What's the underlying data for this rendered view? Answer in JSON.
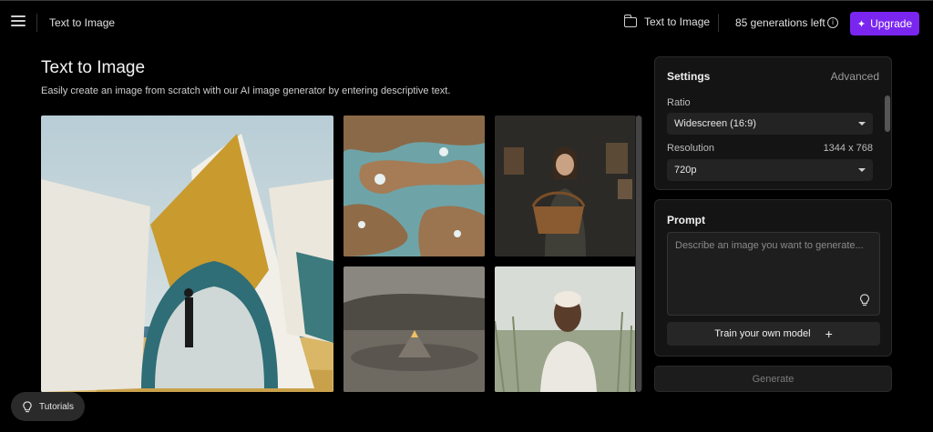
{
  "header": {
    "title": "Text to Image",
    "folder_label": "Text to Image",
    "generations_left": "85 generations left",
    "upgrade_label": "Upgrade",
    "accent_color": "#7a26f0"
  },
  "main": {
    "title": "Text to Image",
    "subtitle": "Easily create an image from scratch with our AI image generator by entering descriptive text."
  },
  "gallery": {
    "images": [
      {
        "name": "abstract-sculpture-image"
      },
      {
        "name": "aerial-ice-landscape-image"
      },
      {
        "name": "woman-with-basket-image"
      },
      {
        "name": "stone-cairn-image"
      },
      {
        "name": "portrait-in-grass-image"
      }
    ]
  },
  "settings": {
    "title": "Settings",
    "advanced_label": "Advanced",
    "ratio_label": "Ratio",
    "ratio_value": "Widescreen (16:9)",
    "resolution_label": "Resolution",
    "resolution_dims": "1344 x 768",
    "resolution_value": "720p"
  },
  "prompt": {
    "title": "Prompt",
    "placeholder": "Describe an image you want to generate...",
    "train_label": "Train your own model",
    "generate_label": "Generate"
  },
  "footer": {
    "tutorials_label": "Tutorials"
  },
  "icons": [
    "menu-icon",
    "folder-icon",
    "info-icon",
    "sparkle-icon",
    "chevron-down-icon",
    "lightbulb-icon",
    "plus-icon"
  ]
}
